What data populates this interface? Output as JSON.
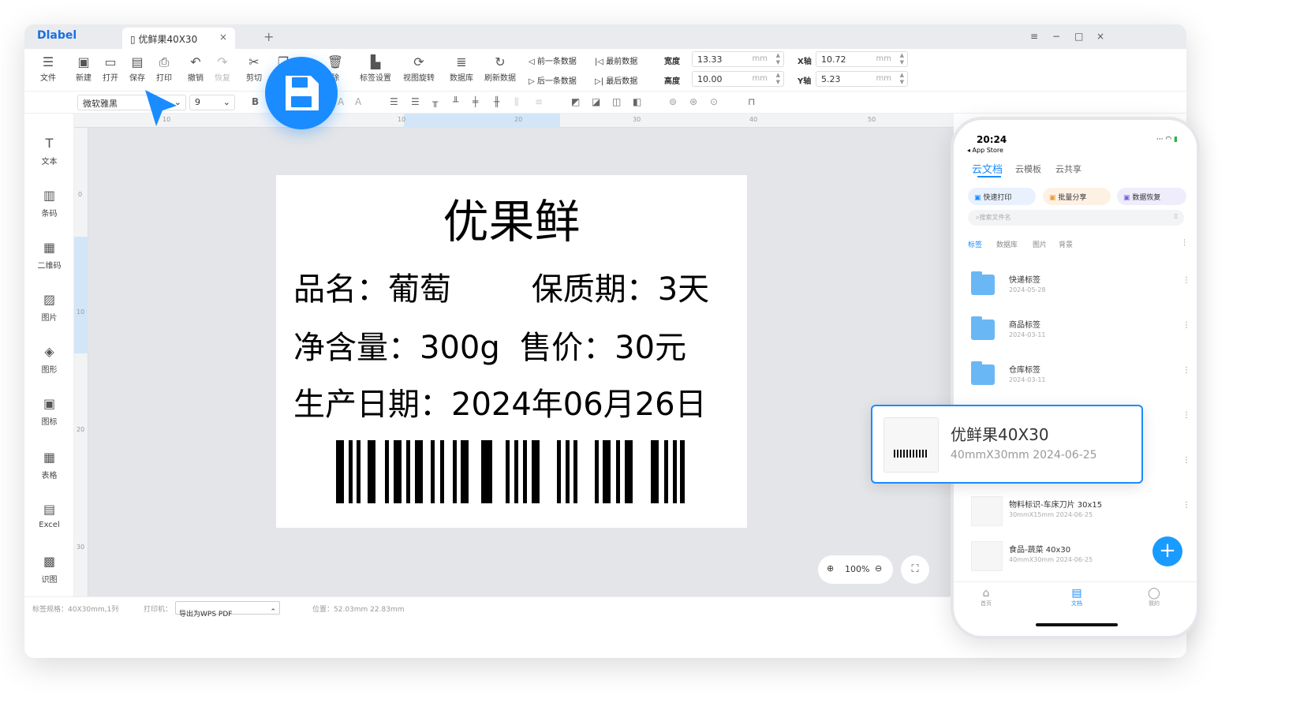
{
  "app": {
    "logo": "label",
    "doc_tab": "优鲜果40X30",
    "tab_close": "×",
    "new_tab": "+",
    "window_controls": [
      "≡",
      "−",
      "□",
      "×"
    ]
  },
  "toolbar": {
    "file": "文件",
    "new": "新建",
    "open": "打开",
    "save": "保存",
    "print": "打印",
    "undo": "撤销",
    "redo": "恢复",
    "cut": "剪切",
    "delete_partial": "除",
    "label_settings": "标签设置",
    "view_rotate": "视图旋转",
    "database": "数据库",
    "refresh_data": "刷新数据",
    "prev_data": "前一条数据",
    "first_data": "最前数据",
    "next_data": "后一条数据",
    "last_data": "最后数据",
    "width_label": "宽度",
    "width_value": "13.33",
    "height_label": "高度",
    "height_value": "10.00",
    "x_label": "X轴",
    "x_value": "10.72",
    "y_label": "Y轴",
    "y_value": "5.23",
    "unit": "mm"
  },
  "format": {
    "font": "微软雅黑",
    "size": "9",
    "bold": "B"
  },
  "sidebar": [
    {
      "label": "文本",
      "icon": "text-icon"
    },
    {
      "label": "条码",
      "icon": "barcode-icon"
    },
    {
      "label": "二维码",
      "icon": "qrcode-icon"
    },
    {
      "label": "图片",
      "icon": "image-icon"
    },
    {
      "label": "图形",
      "icon": "shape-icon"
    },
    {
      "label": "图标",
      "icon": "logo-icon"
    },
    {
      "label": "表格",
      "icon": "table-icon"
    },
    {
      "label": "Excel",
      "icon": "excel-icon"
    },
    {
      "label": "识图",
      "icon": "recognize-icon"
    }
  ],
  "ruler": {
    "top": [
      "10",
      "10",
      "20",
      "30",
      "40",
      "50"
    ],
    "left": [
      "0",
      "10",
      "20",
      "30"
    ]
  },
  "label": {
    "title": "优果鲜",
    "line1": "品名：葡萄        保质期：3天",
    "line2": "净含量：300g  售价：30元",
    "line3": "生产日期：2024年06月26日"
  },
  "zoom": {
    "value": "100%"
  },
  "status": {
    "label_spec": "标签规格：40X30mm,1列",
    "printer_label": "打印机：",
    "printer_value": "导出为WPS PDF",
    "position": "位置：52.03mm 22.83mm"
  },
  "phone": {
    "time": "20:24",
    "back": "◂ App Store",
    "tabs": [
      "云文档",
      "云模板",
      "云共享"
    ],
    "chips": [
      "快速打印",
      "批量分享",
      "数据恢复"
    ],
    "search_placeholder": "搜索文件名",
    "subtabs": [
      "标签",
      "数据库",
      "图片",
      "背景"
    ],
    "folders": [
      {
        "name": "快递标签",
        "date": "2024-05-28"
      },
      {
        "name": "商品标签",
        "date": "2024-03-11"
      },
      {
        "name": "仓库标签",
        "date": "2024-03-11"
      }
    ],
    "files": [
      {
        "name": "物料标识-车床刀片 30x15",
        "meta": "30mmX15mm   2024-06-25"
      },
      {
        "name": "食品-蔬菜 40x30",
        "meta": "40mmX30mm   2024-06-25"
      }
    ],
    "bottom_nav": [
      "首页",
      "文档",
      "我的"
    ],
    "fab": "+"
  },
  "popup": {
    "name": "优鲜果40X30",
    "meta": "40mmX30mm   2024-06-25"
  },
  "colors": {
    "accent": "#1a8cff",
    "folder": "#6ab7f5"
  }
}
